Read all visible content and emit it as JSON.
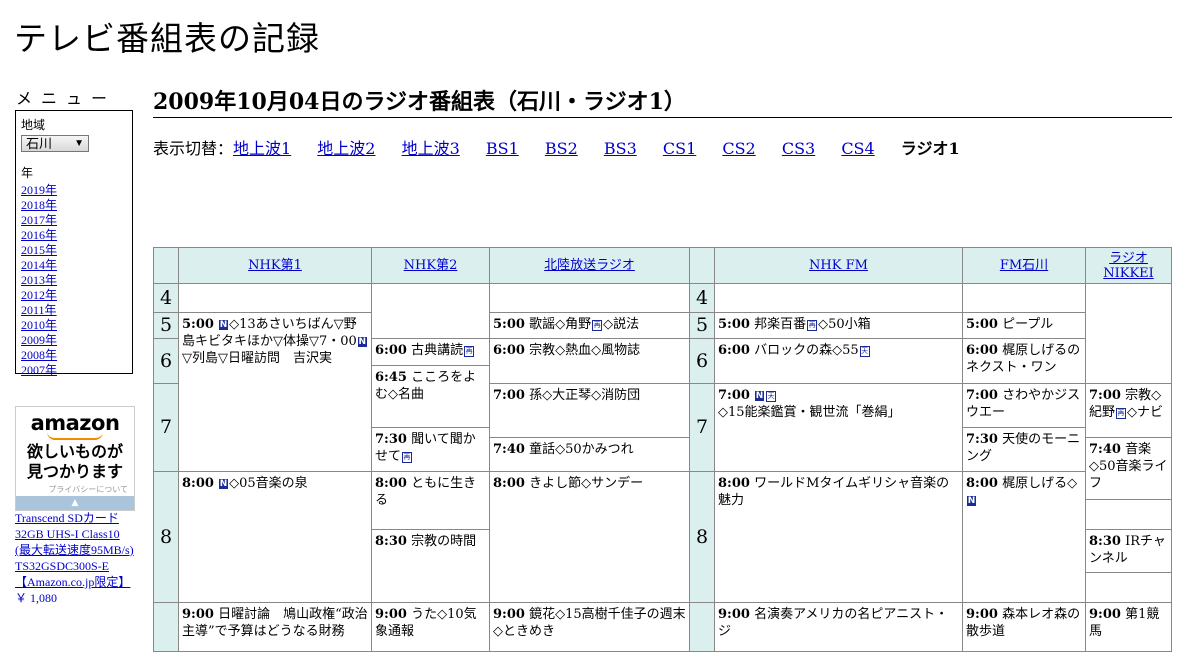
{
  "site": {
    "title": "テレビ番組表の記録"
  },
  "menu": {
    "heading": "メニュー",
    "region_label": "地域",
    "region_value": "石川",
    "year_label": "年",
    "years": [
      "2019年",
      "2018年",
      "2017年",
      "2016年",
      "2015年",
      "2014年",
      "2013年",
      "2012年",
      "2011年",
      "2010年",
      "2009年",
      "2008年",
      "2007年"
    ]
  },
  "ad": {
    "logo": "amazon",
    "tagline_1": "欲しいものが",
    "tagline_2": "見つかります",
    "privacy": "プライバシーについて",
    "product": "Transcend SDカード 32GB UHS-I Class10 (最大転送速度95MB/s) TS32GSDC300S-E【Amazon.co.jp限定】",
    "price": "￥ 1,080"
  },
  "page": {
    "heading": "2009年10月04日のラジオ番組表（石川・ラジオ1）"
  },
  "switcher": {
    "label": "表示切替：",
    "links": [
      "地上波1",
      "地上波2",
      "地上波3",
      "BS1",
      "BS2",
      "BS3",
      "CS1",
      "CS2",
      "CS3",
      "CS4"
    ],
    "current": "ラジオ1"
  },
  "channels": [
    "NHK第1",
    "NHK第2",
    "北陸放送ラジオ",
    "NHK FM",
    "FM石川",
    "ラジオNIKKEI"
  ],
  "hours": [
    "4",
    "5",
    "6",
    "7",
    "8",
    "4",
    "5",
    "6",
    "7",
    "8"
  ],
  "programs": {
    "nhk1_0500": {
      "time": "5:00",
      "pre": "",
      "text": "◇13あさいちばん▽野島キビタキほか▽体操▽7・00",
      "tail": "▽列島▽日曜訪問　吉沢実"
    },
    "nhk1_0800": {
      "time": "8:00",
      "text": "◇05音楽の泉"
    },
    "nhk1_0900": {
      "time": "9:00",
      "text": "日曜討論　鳩山政権“政治主導”で予算はどうなる財務"
    },
    "nhk2_0600": {
      "time": "6:00",
      "text": "古典講読"
    },
    "nhk2_0645": {
      "time": "6:45",
      "text": "こころをよむ◇名曲"
    },
    "nhk2_0730": {
      "time": "7:30",
      "text": "聞いて聞かせて"
    },
    "nhk2_0800": {
      "time": "8:00",
      "text": "ともに生きる"
    },
    "nhk2_0830": {
      "time": "8:30",
      "text": "宗教の時間"
    },
    "nhk2_0900": {
      "time": "9:00",
      "text": "うた◇10気象通報"
    },
    "mro_0500": {
      "time": "5:00",
      "text": "歌謡◇角野",
      "tail": "◇説法"
    },
    "mro_0600": {
      "time": "6:00",
      "text": "宗教◇熱血◇風物誌"
    },
    "mro_0700": {
      "time": "7:00",
      "text": "孫◇大正琴◇消防団"
    },
    "mro_0740": {
      "time": "7:40",
      "text": "童話◇50かみつれ"
    },
    "mro_0800": {
      "time": "8:00",
      "text": "きよし節◇サンデー"
    },
    "mro_0900": {
      "time": "9:00",
      "text": "鏡花◇15高樹千佳子の週末◇ときめき"
    },
    "fm_0500": {
      "time": "5:00",
      "text": "邦楽百番",
      "tail": "◇50小箱"
    },
    "fm_0600": {
      "time": "6:00",
      "text": "バロックの森◇55"
    },
    "fm_0700": {
      "time": "7:00",
      "text": "◇15能楽鑑賞・観世流「巻絹」"
    },
    "fm_0800": {
      "time": "8:00",
      "text": "ワールドMタイムギリシャ音楽の魅力"
    },
    "fm_0900": {
      "time": "9:00",
      "text": "名演奏アメリカの名ピアニスト・ジ"
    },
    "fmi_0500": {
      "time": "5:00",
      "text": "ピープル"
    },
    "fmi_0600": {
      "time": "6:00",
      "text": "梶原しげるのネクスト・ワン"
    },
    "fmi_0700": {
      "time": "7:00",
      "text": "さわやかジスウエー"
    },
    "fmi_0730": {
      "time": "7:30",
      "text": "天使のモーニング"
    },
    "fmi_0800": {
      "time": "8:00",
      "text": "梶原しげる◇"
    },
    "fmi_0900": {
      "time": "9:00",
      "text": "森本レオ森の散歩道"
    },
    "nk_0700": {
      "time": "7:00",
      "text": "宗教◇紀野",
      "tail": "◇ナビ"
    },
    "nk_0740": {
      "time": "7:40",
      "text": "音楽◇50音楽ライフ"
    },
    "nk_0830": {
      "time": "8:30",
      "text": "IRチャンネル"
    },
    "nk_0900": {
      "time": "9:00",
      "text": "第1競馬"
    }
  },
  "badges": {
    "news": "N",
    "rebroadcast": "再",
    "weather": "天",
    "stereo": "文"
  }
}
